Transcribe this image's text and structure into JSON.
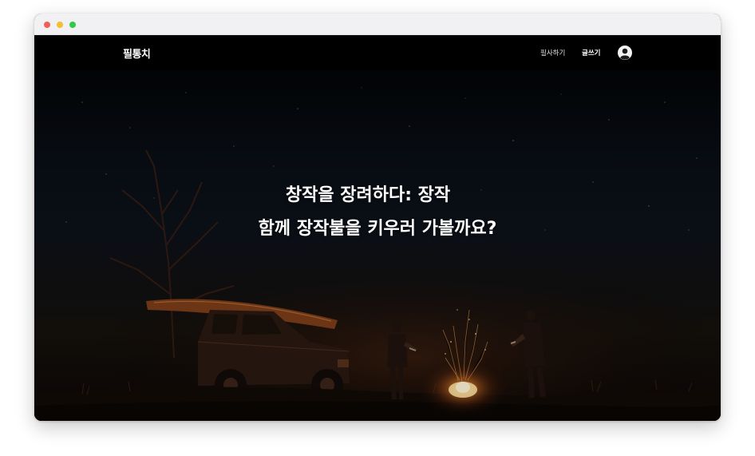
{
  "app": {
    "logo_text": "필통치"
  },
  "nav": {
    "transcribe_label": "필사하기",
    "write_label": "글쓰기",
    "avatar_icon": "user-avatar-icon"
  },
  "hero": {
    "title_line1": "창작을 장려하다: 장작",
    "title_line2": "함께 장작불을 키우러 가볼까요?",
    "image_subject": "campfire-night-scene"
  },
  "colors": {
    "titlebar": "#f1f1f3",
    "close": "#f25f57",
    "minimize": "#f6bd2f",
    "maximize": "#32c949",
    "navbar": "#000000",
    "fire": "#ffb347"
  }
}
